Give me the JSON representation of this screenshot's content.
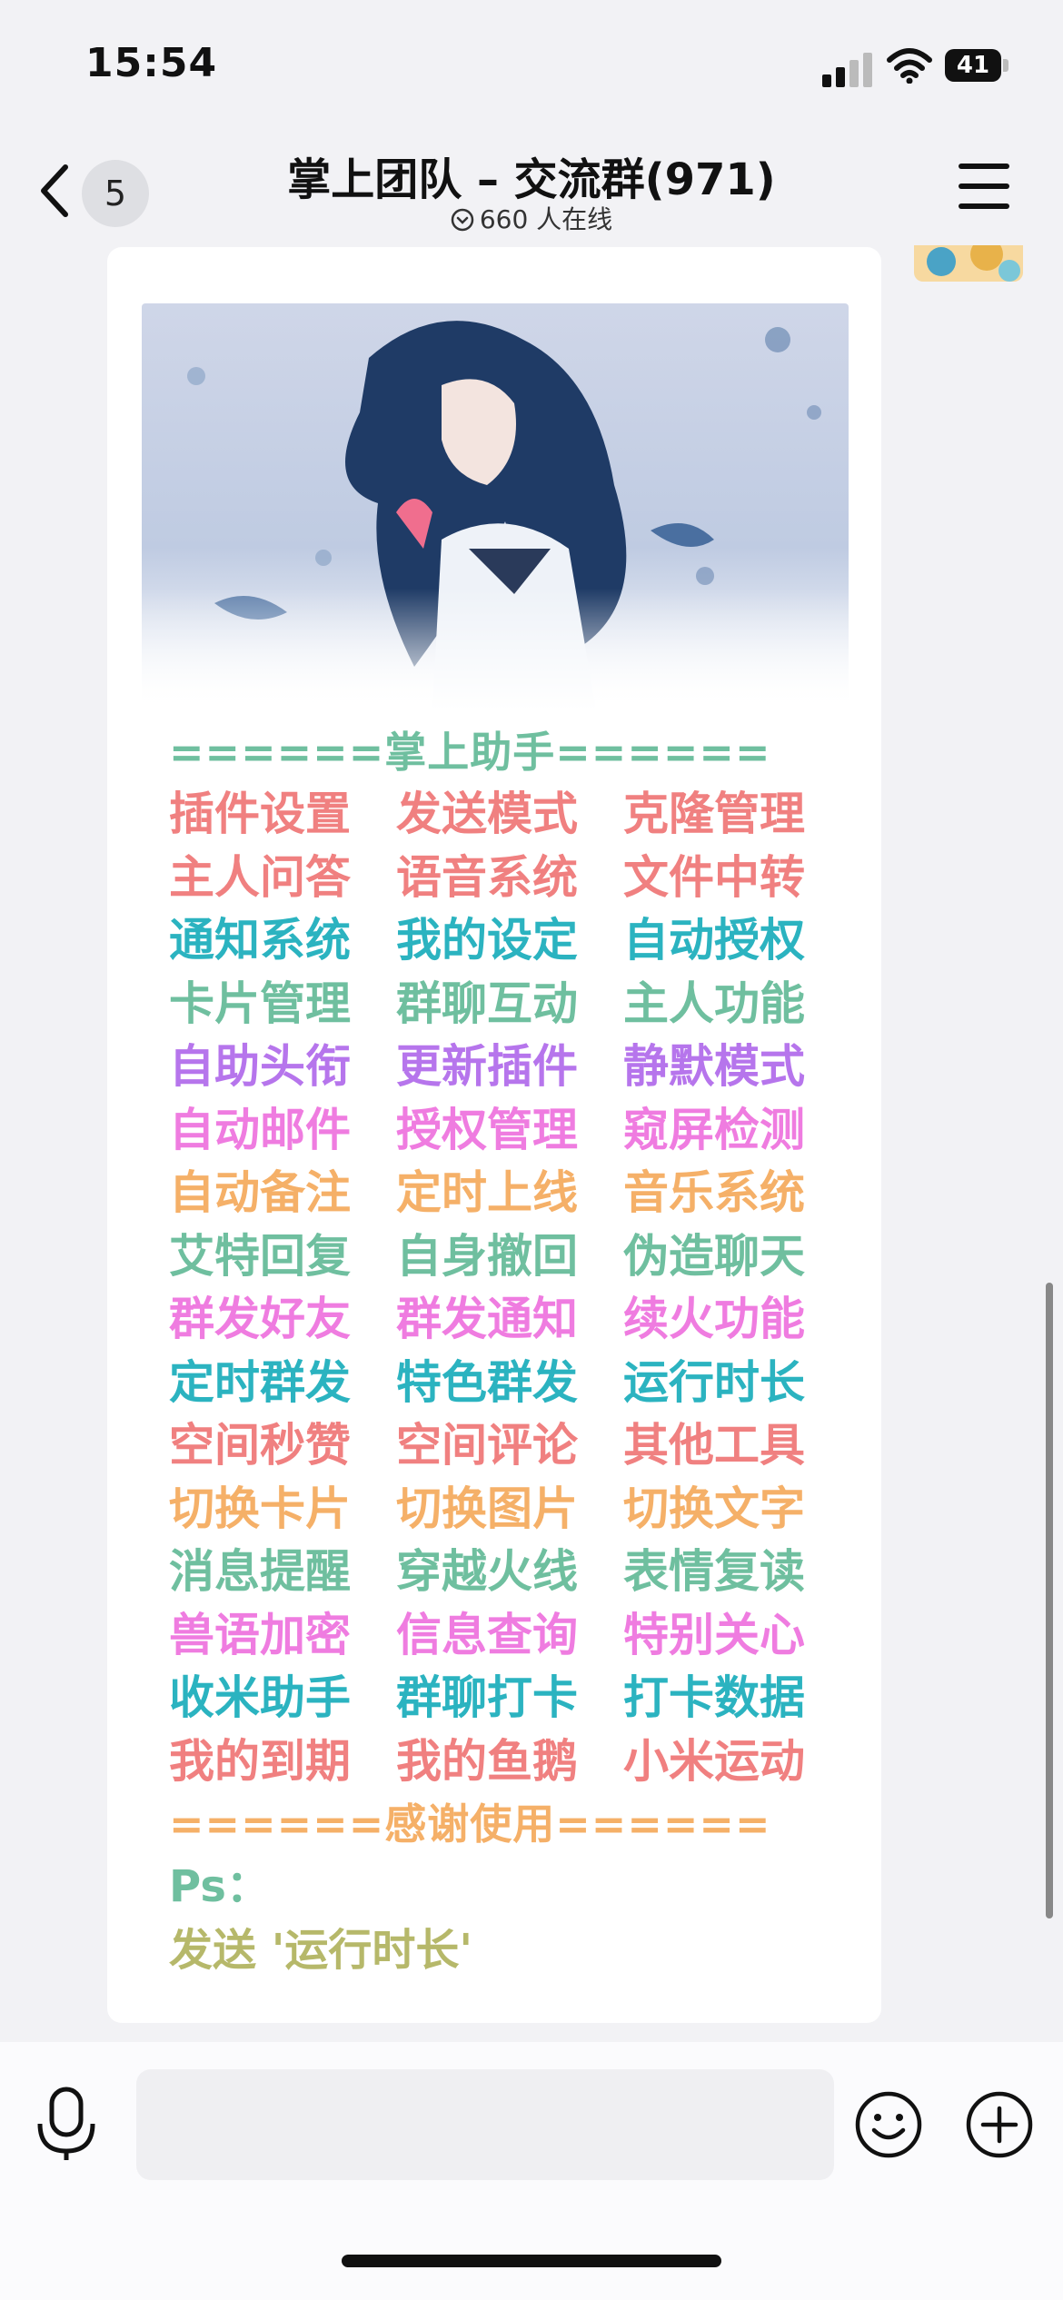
{
  "status_bar": {
    "time": "15:54",
    "battery": "41"
  },
  "nav": {
    "unread_count": "5",
    "title": "掌上团队 – 交流群(971)",
    "online": "660 人在线"
  },
  "message": {
    "header": "======掌上助手======",
    "rows": [
      {
        "color": "#f08080",
        "items": [
          "插件设置",
          "发送模式",
          "克隆管理"
        ]
      },
      {
        "color": "#f08080",
        "items": [
          "主人问答",
          "语音系统",
          "文件中转"
        ]
      },
      {
        "color": "#2bb3c0",
        "items": [
          "通知系统",
          "我的设定",
          "自动授权"
        ]
      },
      {
        "color": "#6fbf9f",
        "items": [
          "卡片管理",
          "群聊互动",
          "主人功能"
        ]
      },
      {
        "color": "#b675ec",
        "items": [
          "自助头衔",
          "更新插件",
          "静默模式"
        ]
      },
      {
        "color": "#ef7ce0",
        "items": [
          "自动邮件",
          "授权管理",
          "窥屏检测"
        ]
      },
      {
        "color": "#f5b068",
        "items": [
          "自动备注",
          "定时上线",
          "音乐系统"
        ]
      },
      {
        "color": "#6fbf9f",
        "items": [
          "艾特回复",
          "自身撤回",
          "伪造聊天"
        ]
      },
      {
        "color": "#ef7ce0",
        "items": [
          "群发好友",
          "群发通知",
          "续火功能"
        ]
      },
      {
        "color": "#2bb3c0",
        "items": [
          "定时群发",
          "特色群发",
          "运行时长"
        ]
      },
      {
        "color": "#f08080",
        "items": [
          "空间秒赞",
          "空间评论",
          "其他工具"
        ]
      },
      {
        "color": "#f5b068",
        "items": [
          "切换卡片",
          "切换图片",
          "切换文字"
        ]
      },
      {
        "color": "#6fbf9f",
        "items": [
          "消息提醒",
          "穿越火线",
          "表情复读"
        ]
      },
      {
        "color": "#ef7ce0",
        "items": [
          "兽语加密",
          "信息查询",
          "特别关心"
        ]
      },
      {
        "color": "#2bb3c0",
        "items": [
          "收米助手",
          "群聊打卡",
          "打卡数据"
        ]
      },
      {
        "color": "#f08080",
        "items": [
          "我的到期",
          "我的鱼鹅",
          "小米运动"
        ]
      }
    ],
    "footer": "======感谢使用======",
    "ps_label": "Ps：",
    "ps_text": "发送 '运行时长'",
    "header_color": "#6fbf9f",
    "footer_color": "#f5b068",
    "ps_label_color": "#6fbf9f",
    "ps_text_color": "#b6b86a"
  },
  "input": {
    "placeholder": ""
  }
}
